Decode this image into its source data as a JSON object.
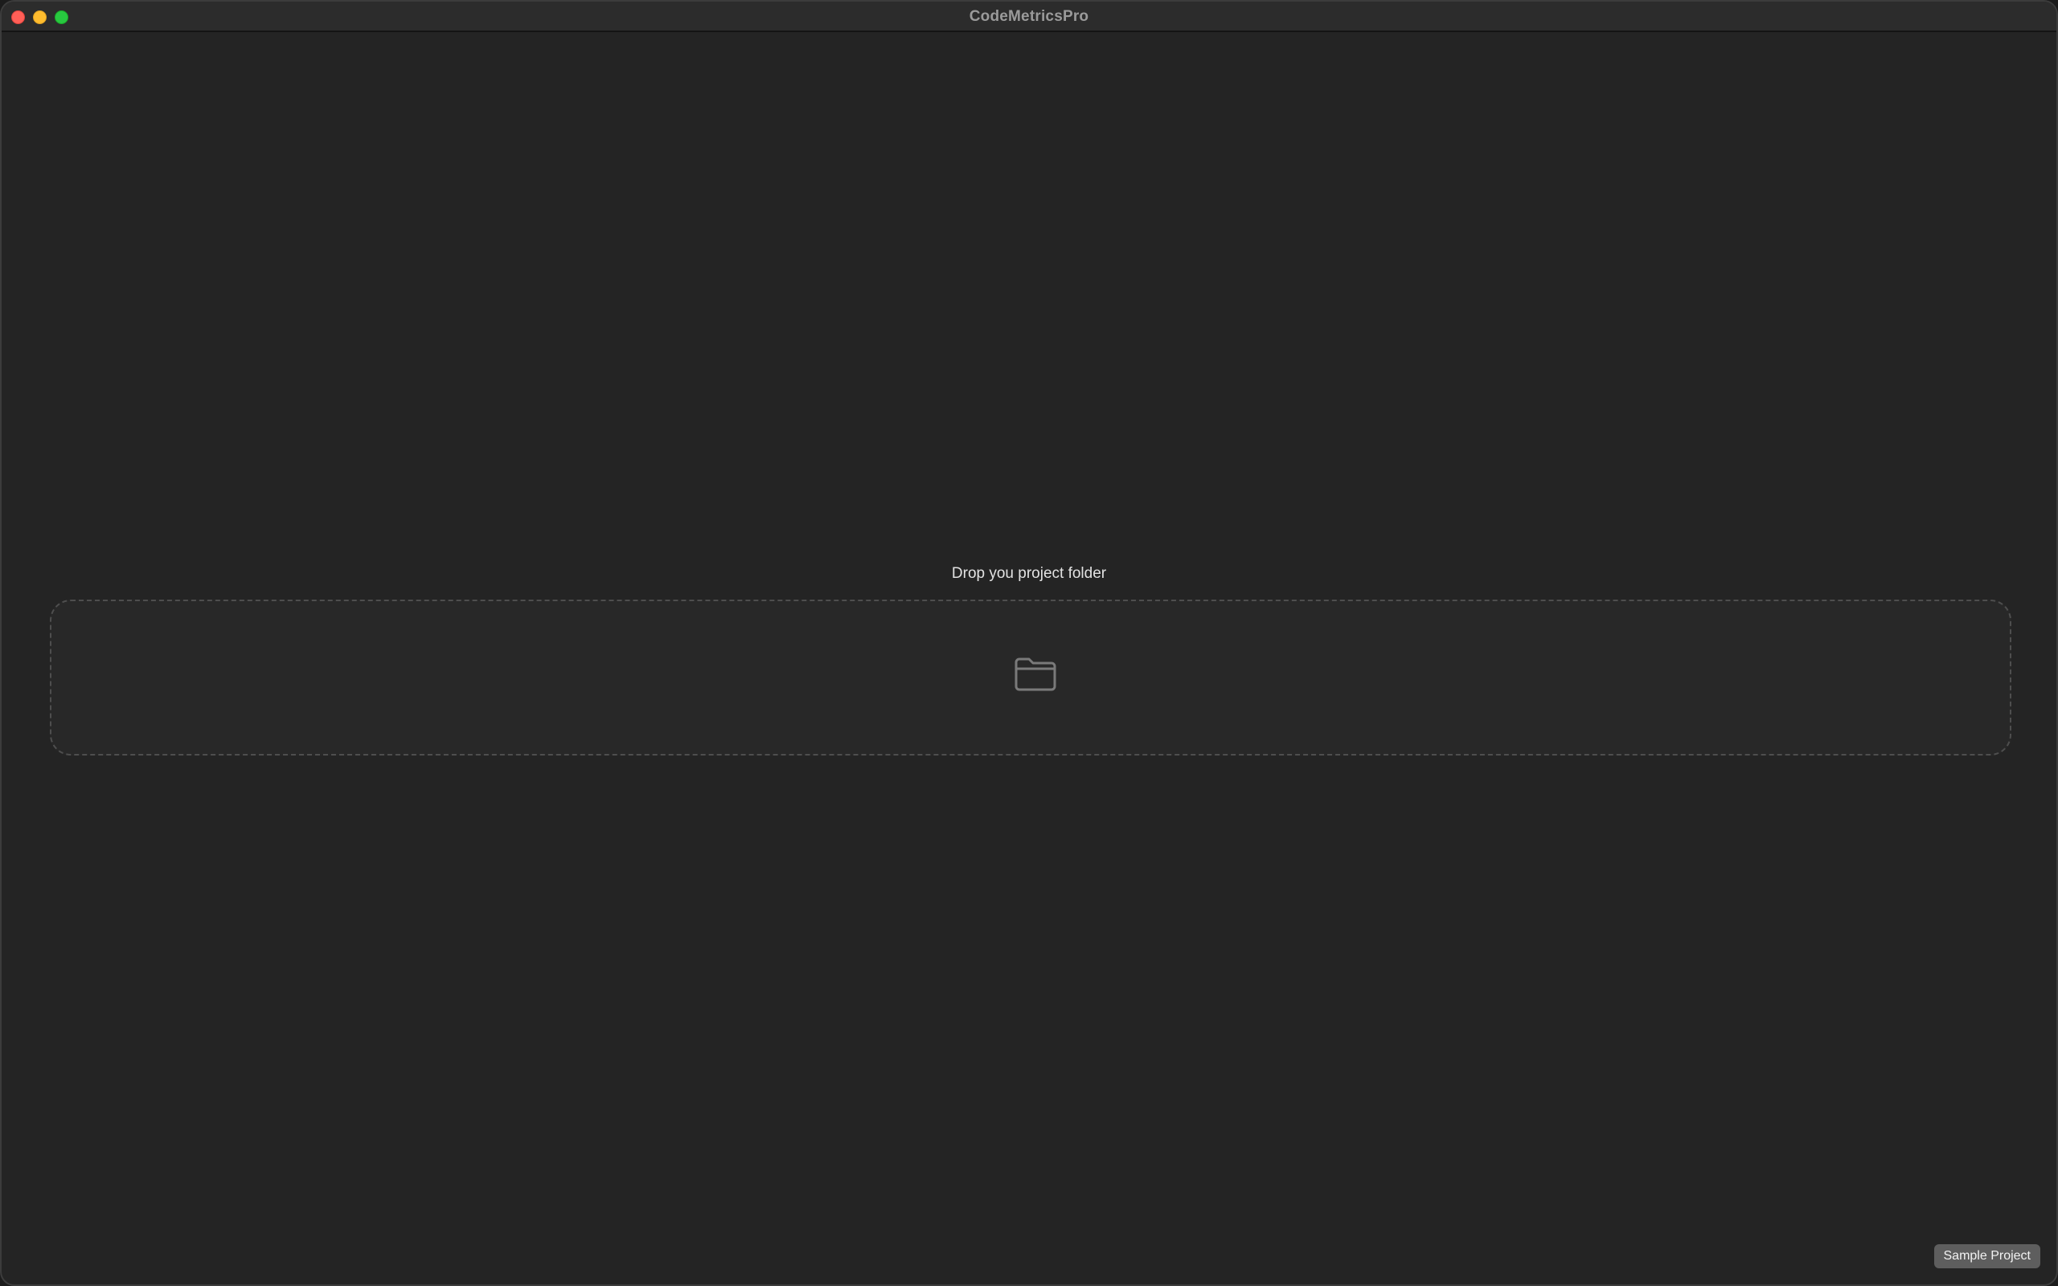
{
  "window": {
    "title": "CodeMetricsPro"
  },
  "dropzone": {
    "label": "Drop you project folder",
    "icon": "folder-icon"
  },
  "footer": {
    "sample_project_label": "Sample Project"
  },
  "colors": {
    "close": "#ff5f57",
    "minimize": "#febc2e",
    "zoom": "#28c840",
    "background": "#242424",
    "dash_border": "#4e4e4e",
    "button_bg": "#5e5e5e"
  }
}
